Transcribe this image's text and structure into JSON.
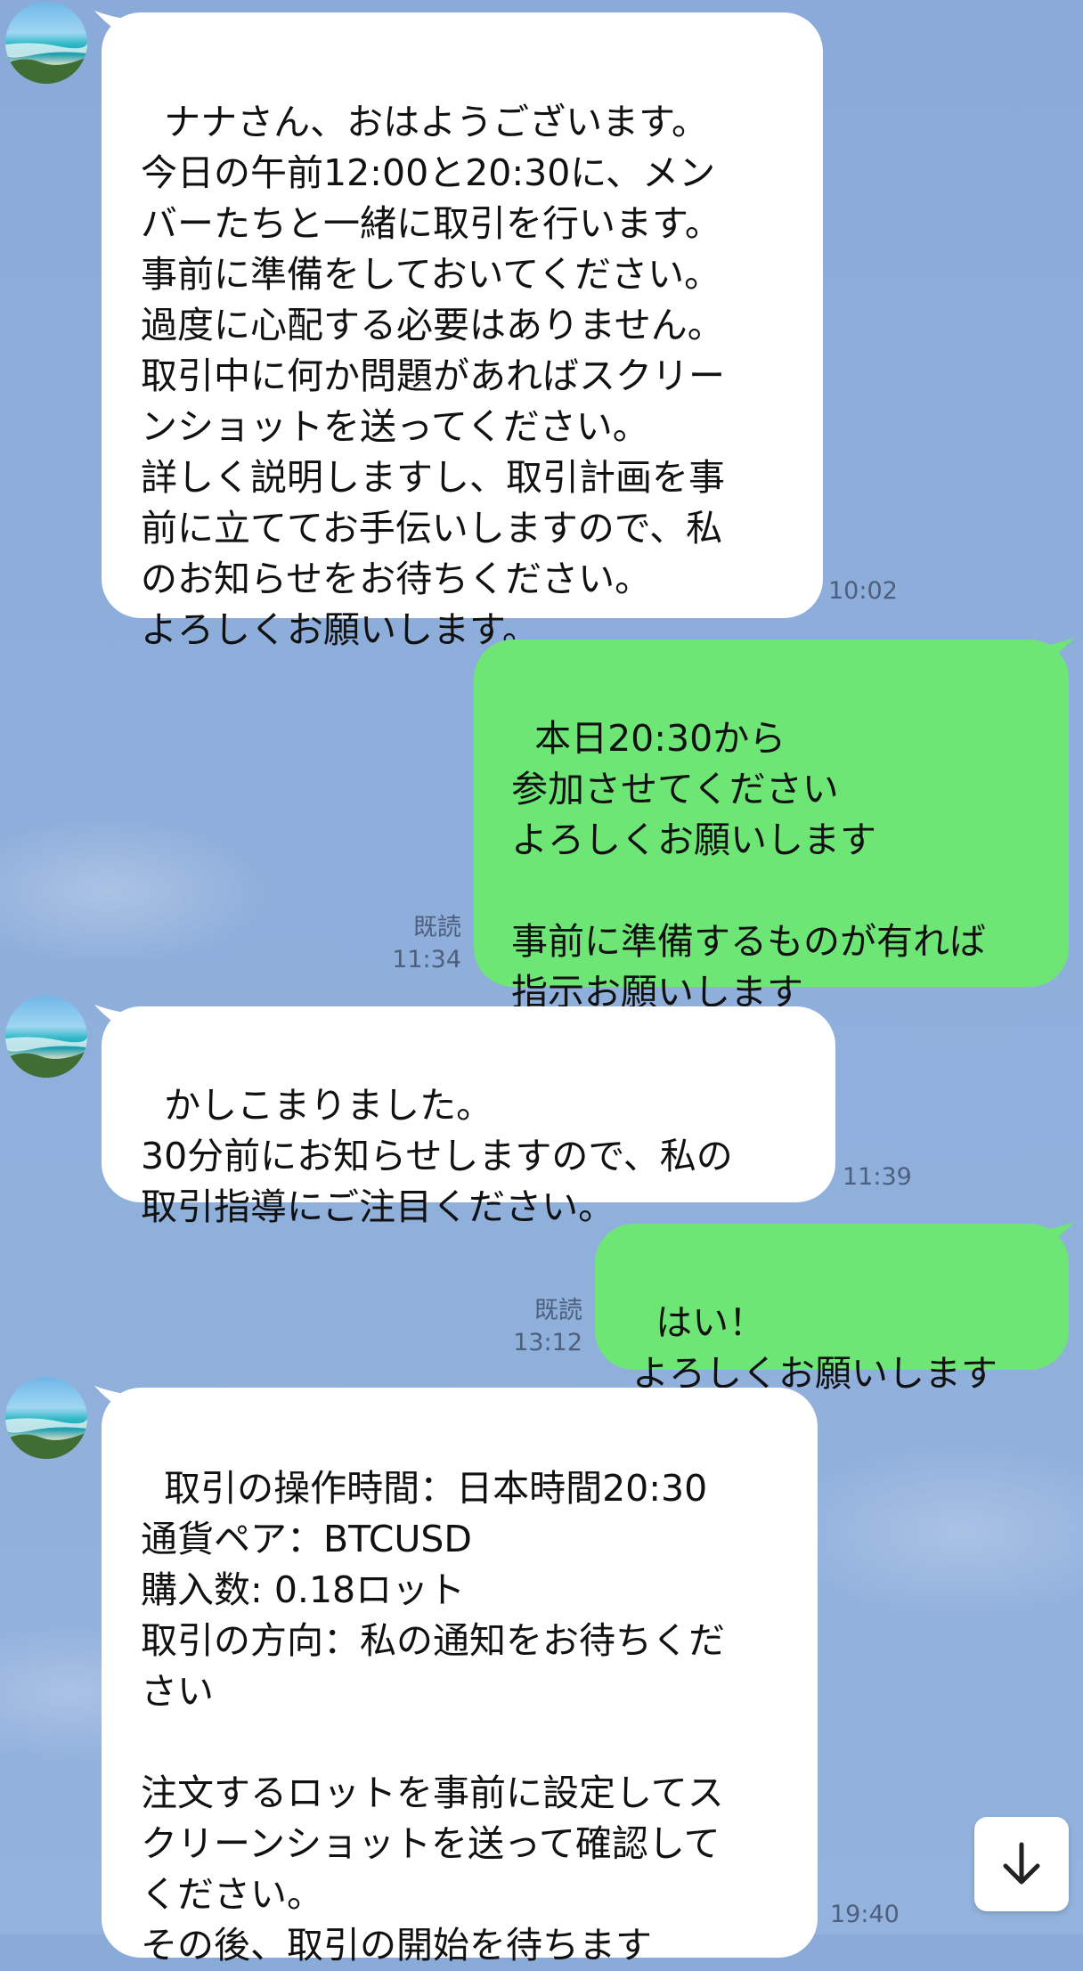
{
  "contact": {
    "avatar_icon": "beach-avatar-icon"
  },
  "messages": [
    {
      "side": "in",
      "text": "ナナさん、おはようございます。\n今日の午前12:00と20:30に、メン\nバーたちと一緒に取引を行います。\n事前に準備をしておいてください。\n過度に心配する必要はありません。\n取引中に何か問題があればスクリー\nンショットを送ってください。\n詳しく説明しますし、取引計画を事\n前に立ててお手伝いしますので、私\nのお知らせをお待ちください。\nよろしくお願いします。",
      "time": "10:02"
    },
    {
      "side": "out",
      "text": "本日20:30から\n参加させてください\nよろしくお願いします\n\n事前に準備するものが有れば\n指示お願いします",
      "read": "既読",
      "time": "11:34"
    },
    {
      "side": "in",
      "text": "かしこまりました。\n30分前にお知らせしますので、私の\n取引指導にご注目ください。",
      "time": "11:39"
    },
    {
      "side": "out",
      "text": "はい！\nよろしくお願いします",
      "read": "既読",
      "time": "13:12"
    },
    {
      "side": "in",
      "text": "取引の操作時間：日本時間20:30\n通貨ペア：BTCUSD\n購入数: 0.18ロット\n取引の方向：私の通知をお待ちくだ\nさい\n\n注文するロットを事前に設定してス\nクリーンショットを送って確認して\nください。\nその後、取引の開始を待ちます",
      "time": "19:40"
    }
  ],
  "controls": {
    "scroll_down_icon": "arrow-down-icon"
  },
  "colors": {
    "background": "#8aaad8",
    "incoming_bubble": "#ffffff",
    "outgoing_bubble": "#6ee676",
    "meta_text": "#4e5f7c"
  }
}
